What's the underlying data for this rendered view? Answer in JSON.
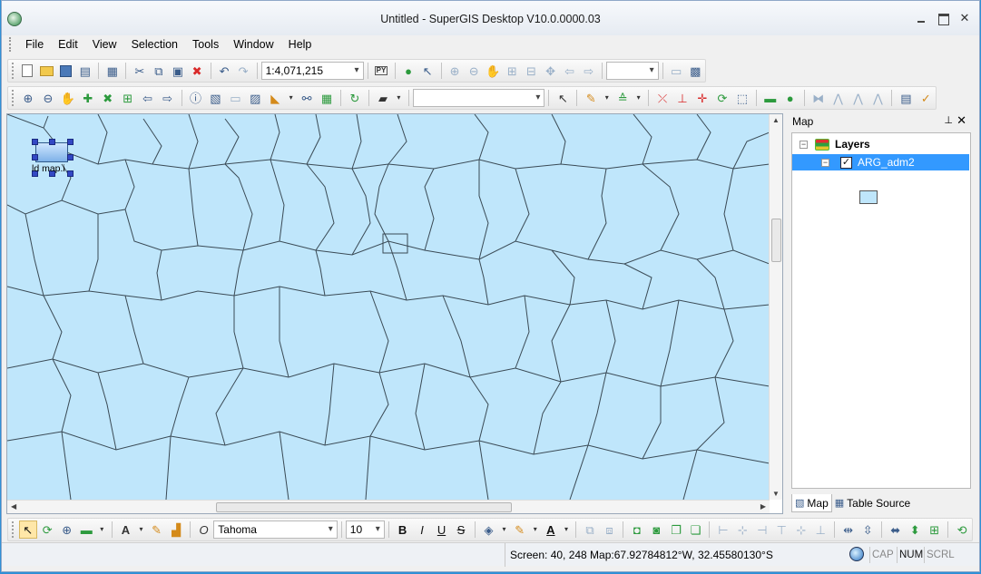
{
  "window": {
    "title": "Untitled - SuperGIS Desktop V10.0.0000.03"
  },
  "menu": [
    "File",
    "Edit",
    "View",
    "Selection",
    "Tools",
    "Window",
    "Help"
  ],
  "standard_toolbar": {
    "scale": "1:4,071,215",
    "zoom_combo": ""
  },
  "nav_toolbar": {
    "layer_combo": ""
  },
  "draw_toolbar": {
    "font": "Tahoma",
    "size": "10",
    "bold": "B",
    "italic": "I",
    "underline": "U",
    "strike": "S"
  },
  "map": {
    "fill_color": "#bfe6fb",
    "legend_element_label": "ld map.i",
    "polygons": "ARG_adm2 administrative boundaries"
  },
  "panel": {
    "title": "Map",
    "tree": {
      "root": "Layers",
      "layer": "ARG_adm2",
      "layer_checked": true
    },
    "tabs": [
      "Map",
      "Table Source"
    ]
  },
  "status": {
    "coords": "Screen: 40, 248  Map:67.92784812°W, 32.45580130°S",
    "cap": "CAP",
    "num": "NUM",
    "scrl": "SCRL"
  }
}
